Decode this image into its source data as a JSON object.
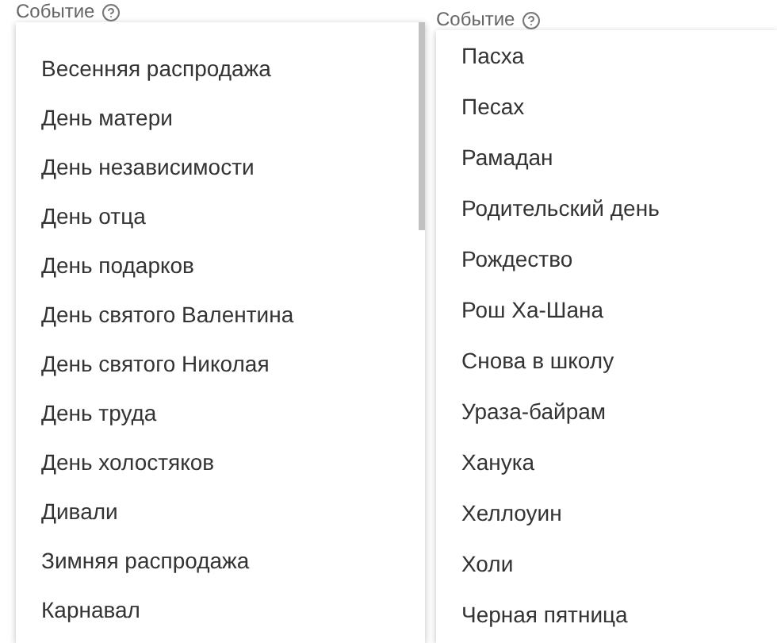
{
  "fields": [
    {
      "label": "Событие",
      "options": [
        "Весенняя распродажа",
        "День матери",
        "День независимости",
        "День отца",
        "День подарков",
        "День святого Валентина",
        "День святого Николая",
        "День труда",
        "День холостяков",
        "Дивали",
        "Зимняя распродажа",
        "Карнавал"
      ]
    },
    {
      "label": "Событие",
      "options": [
        "Пасха",
        "Песах",
        "Рамадан",
        "Родительский день",
        "Рождество",
        "Рош Ха-Шана",
        "Снова в школу",
        "Ураза-байрам",
        "Ханука",
        "Хеллоуин",
        "Холи",
        "Черная пятница"
      ]
    }
  ]
}
